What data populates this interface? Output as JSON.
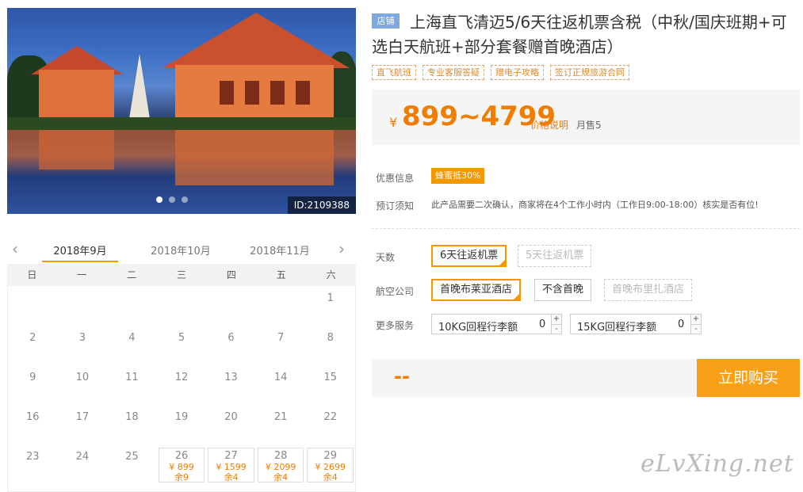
{
  "product": {
    "image_id": "ID:2109388",
    "carousel_count": 3,
    "carousel_active": 0,
    "shop_tag": "店铺",
    "title": "上海直飞清迈5/6天往返机票含税（中秋/国庆班期+可选白天航班+部分套餐赠首晚酒店）",
    "features": [
      "直飞航班",
      "专业客服答疑",
      "赠电子攻略",
      "签订正规旅游合同"
    ],
    "price_symbol": "¥",
    "price": "899~4799",
    "price_note": "价格说明",
    "sold": "月售5"
  },
  "info": {
    "promo_label": "优惠信息",
    "promo_tag": "蜂蜜抵30%",
    "notice_label": "预订须知",
    "notice_text": "此产品需要二次确认，商家将在4个工作小时内（工作日9:00-18:00）核实是否有位!"
  },
  "options": {
    "days_label": "天数",
    "days": [
      {
        "label": "6天往返机票",
        "state": "selected"
      },
      {
        "label": "5天往返机票",
        "state": "disabled"
      }
    ],
    "airline_label": "航空公司",
    "airline": [
      {
        "label": "首晚布莱亚酒店",
        "state": "selected"
      },
      {
        "label": "不含首晚",
        "state": "normal"
      },
      {
        "label": "首晚布里扎酒店",
        "state": "disabled"
      }
    ],
    "services_label": "更多服务",
    "services": [
      {
        "name": "10KG回程行李额",
        "qty": "0"
      },
      {
        "name": "15KG回程行李额",
        "qty": "0"
      }
    ],
    "step_plus": "+",
    "step_minus": "-"
  },
  "purchase": {
    "total": "--",
    "buy_label": "立即购买"
  },
  "calendar": {
    "prev_arrow": "‹",
    "next_arrow": "›",
    "months": [
      "2018年9月",
      "2018年10月",
      "2018年11月"
    ],
    "active_month": 0,
    "weekdays": [
      "日",
      "一",
      "二",
      "三",
      "四",
      "五",
      "六"
    ],
    "first_weekday": 6,
    "days_in_view": 29,
    "availability": {
      "26": {
        "price": "¥ 899",
        "left": "余9"
      },
      "27": {
        "price": "¥ 1599",
        "left": "余4"
      },
      "28": {
        "price": "¥ 2099",
        "left": "余4"
      },
      "29": {
        "price": "¥ 2699",
        "left": "余4"
      }
    }
  },
  "watermark": "eLvXing.net"
}
